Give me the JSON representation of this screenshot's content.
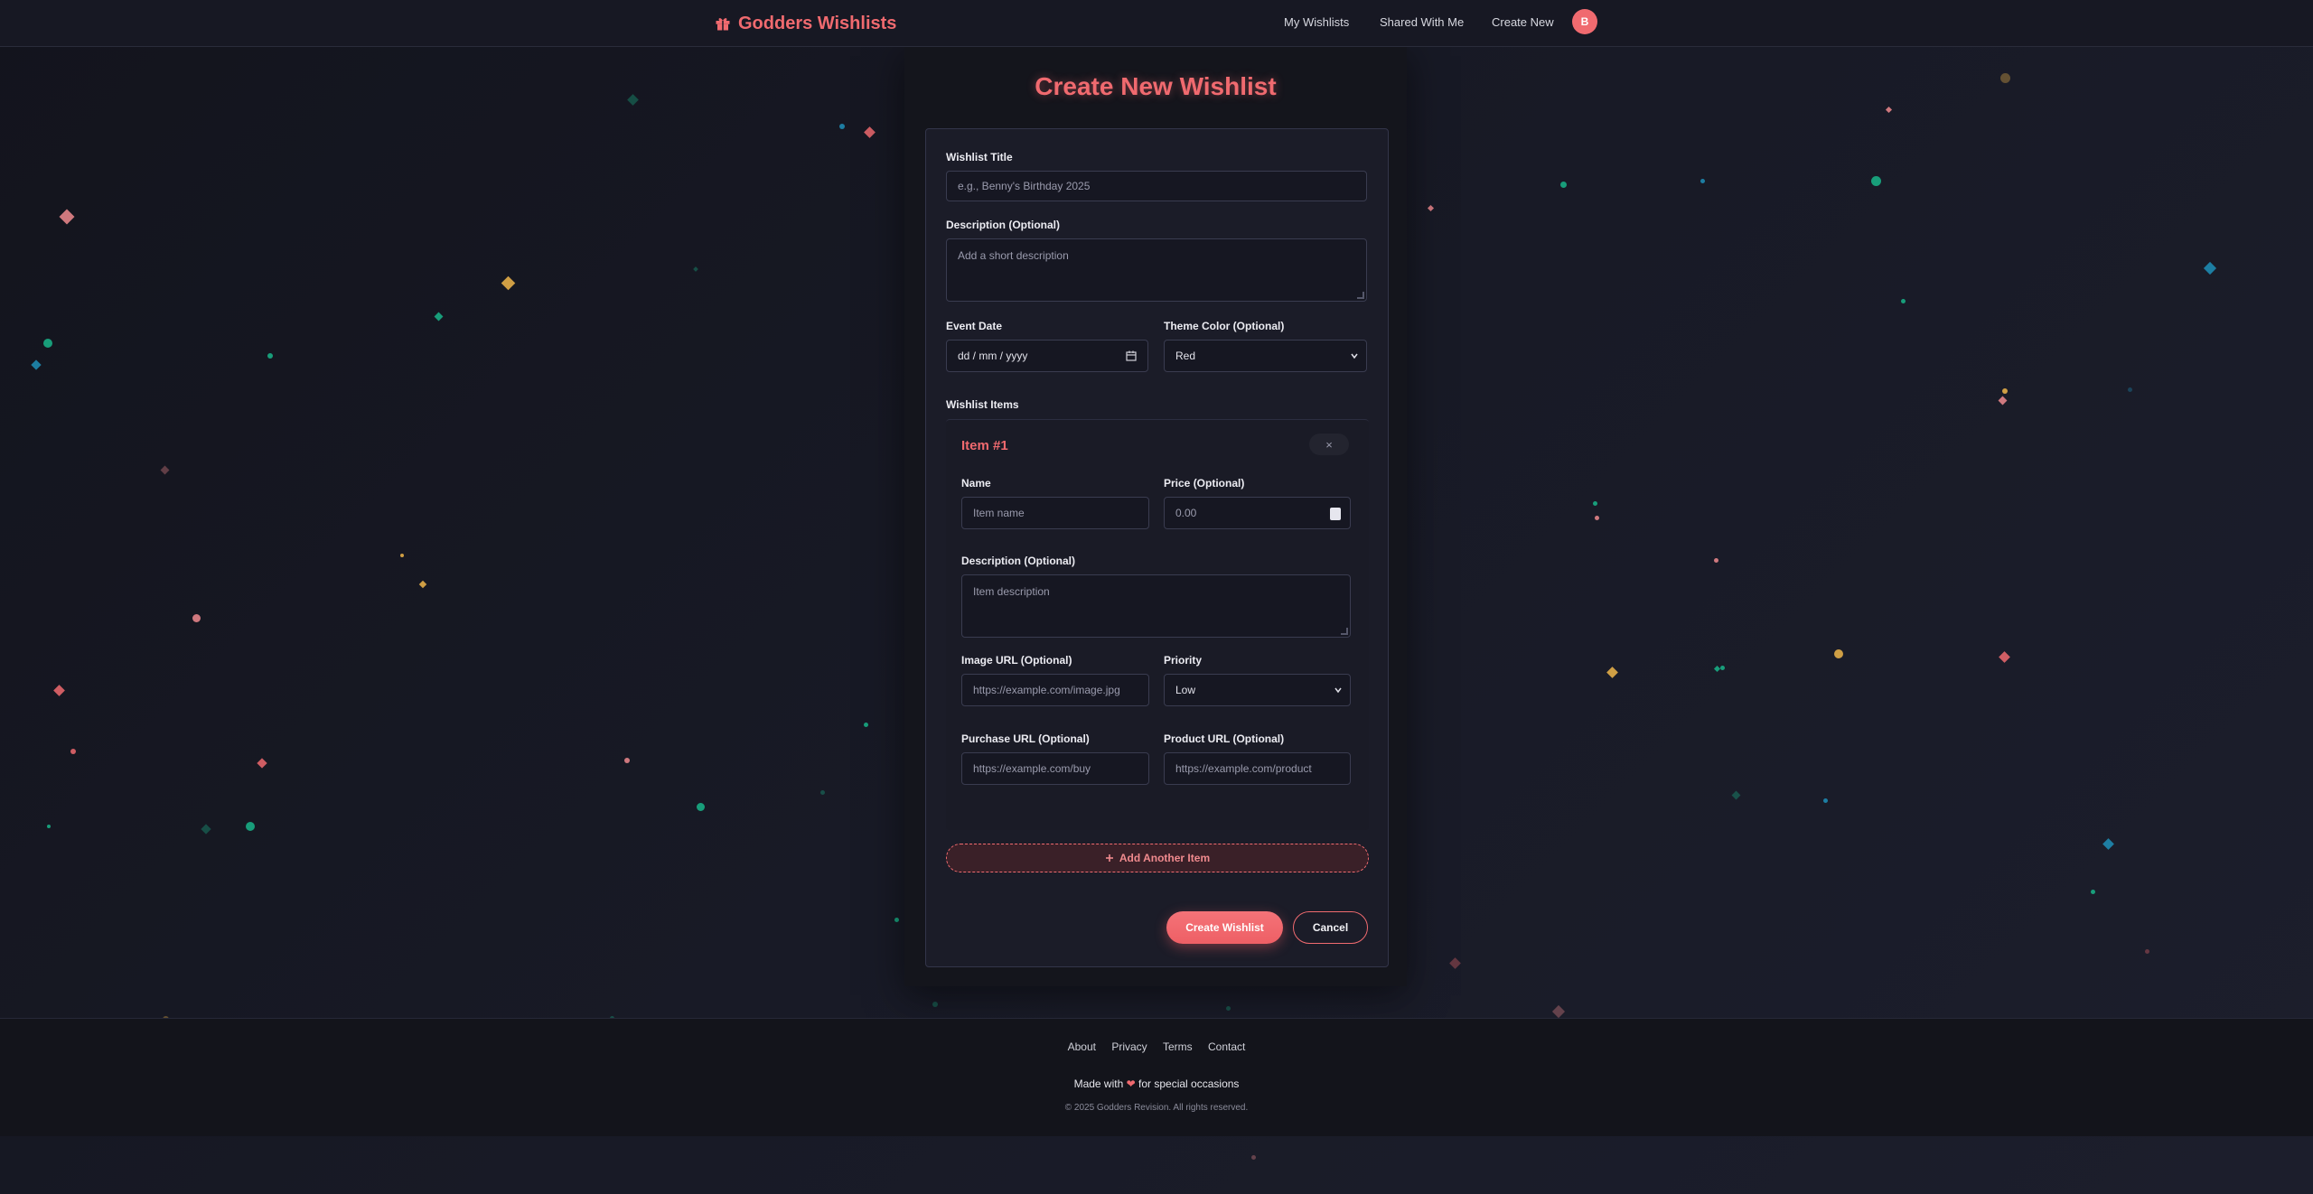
{
  "header": {
    "brand": "Godders Wishlists",
    "nav": [
      "My Wishlists",
      "Shared With Me",
      "Create New"
    ],
    "avatar_initial": "B"
  },
  "page": {
    "title": "Create New Wishlist"
  },
  "form": {
    "title_label": "Wishlist Title",
    "title_placeholder": "e.g., Benny's Birthday 2025",
    "description_label": "Description (Optional)",
    "description_placeholder": "Add a short description",
    "event_date_label": "Event Date",
    "event_date_placeholder": "dd / mm / yyyy",
    "theme_label": "Theme Color (Optional)",
    "theme_value": "Red",
    "items_label": "Wishlist Items",
    "add_item_label": "Add Another Item",
    "create_label": "Create Wishlist",
    "cancel_label": "Cancel"
  },
  "item": {
    "title": "Item #1",
    "close_icon": "×",
    "name_label": "Name",
    "name_placeholder": "Item name",
    "price_label": "Price (Optional)",
    "price_value": "0.00",
    "description_label": "Description (Optional)",
    "description_placeholder": "Item description",
    "image_label": "Image URL (Optional)",
    "image_placeholder": "https://example.com/image.jpg",
    "priority_label": "Priority",
    "priority_value": "Low",
    "purchase_label": "Purchase URL (Optional)",
    "purchase_placeholder": "https://example.com/buy",
    "product_label": "Product URL (Optional)",
    "product_placeholder": "https://example.com/product"
  },
  "footer": {
    "links": [
      "About",
      "Privacy",
      "Terms",
      "Contact"
    ],
    "made_prefix": "Made with",
    "made_suffix": "for special occasions",
    "copyright": "© 2025 Godders Revision. All rights reserved."
  },
  "colors": {
    "accent": "#f06a6f",
    "background": "#161722",
    "confetti": [
      "#f06a6f",
      "#19b58a",
      "#f0b64a",
      "#1f8fb8",
      "#f08a8e",
      "#e08ab0"
    ]
  },
  "icons": [
    "gift-icon",
    "calendar-icon",
    "chevron-down-icon",
    "close-icon",
    "plus-icon",
    "heart-icon"
  ]
}
